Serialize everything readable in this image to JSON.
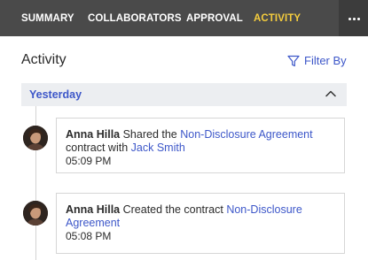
{
  "tabs": [
    {
      "label": "SUMMARY",
      "active": false
    },
    {
      "label": "COLLABORATORS",
      "active": false
    },
    {
      "label": "APPROVAL",
      "active": false
    },
    {
      "label": "ACTIVITY",
      "active": true
    }
  ],
  "more_menu": {
    "icon": "more-horizontal-icon"
  },
  "activity": {
    "title": "Activity",
    "filter_label": "Filter By",
    "filter_icon": "filter-icon"
  },
  "group": {
    "label": "Yesterday",
    "chevron_icon": "chevron-up-icon",
    "expanded": true
  },
  "events": [
    {
      "user": "Anna Hilla",
      "action": " Shared the ",
      "document": "Non-Disclosure Agreement",
      "suffix": " contract with ",
      "target": "Jack Smith",
      "time": "05:09 PM"
    },
    {
      "user": "Anna Hilla",
      "action": " Created the contract ",
      "document": "Non-Disclosure Agreement",
      "time": "05:08 PM"
    }
  ],
  "colors": {
    "topbar": "#4a4a4a",
    "active_tab": "#f5cd3d",
    "link": "#3d57c9",
    "group_bg": "#eceef1"
  }
}
